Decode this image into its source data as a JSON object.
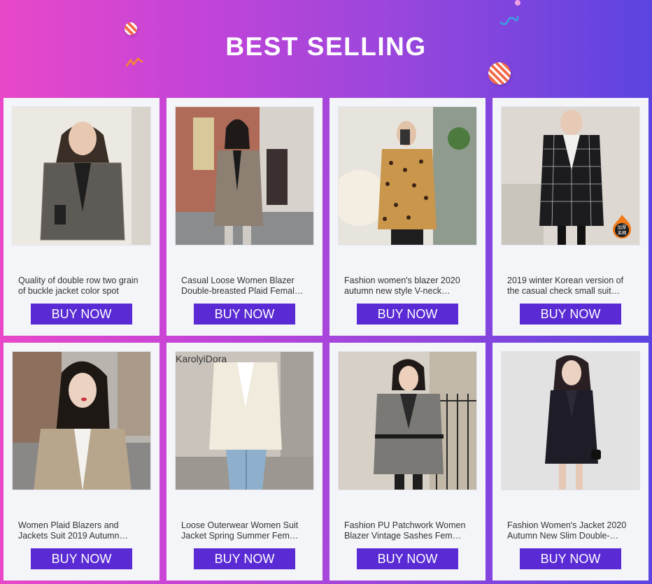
{
  "header": {
    "title": "BEST SELLING"
  },
  "products": [
    {
      "name": "Quality of double row two grain of buckle jacket color spot",
      "button": "BUY NOW"
    },
    {
      "name": "Casual Loose Women Blazer Double-breasted Plaid Femal…",
      "button": "BUY NOW"
    },
    {
      "name": "Fashion women's blazer 2020 autumn new style V-neck…",
      "button": "BUY NOW"
    },
    {
      "name": "2019 winter Korean version of the casual check small suit…",
      "button": "BUY NOW"
    },
    {
      "name": "Women Plaid Blazers and Jackets Suit 2019 Autumn…",
      "button": "BUY NOW"
    },
    {
      "name": "Loose Outerwear Women Suit Jacket Spring Summer Fem…",
      "button": "BUY NOW"
    },
    {
      "name": "Fashion PU Patchwork Women Blazer Vintage Sashes Fem…",
      "button": "BUY NOW"
    },
    {
      "name": "Fashion Women's Jacket 2020 Autumn New Slim Double-…",
      "button": "BUY NOW"
    }
  ],
  "image_text": {
    "brand_watermark": "KarolyiDora",
    "badge_line1": "加厚",
    "badge_line2": "夹棉"
  },
  "colors": {
    "button": "#5a2bd4",
    "card": "#f4f5f9",
    "gradient_left": "#e848c8",
    "gradient_right": "#5c44e0"
  }
}
